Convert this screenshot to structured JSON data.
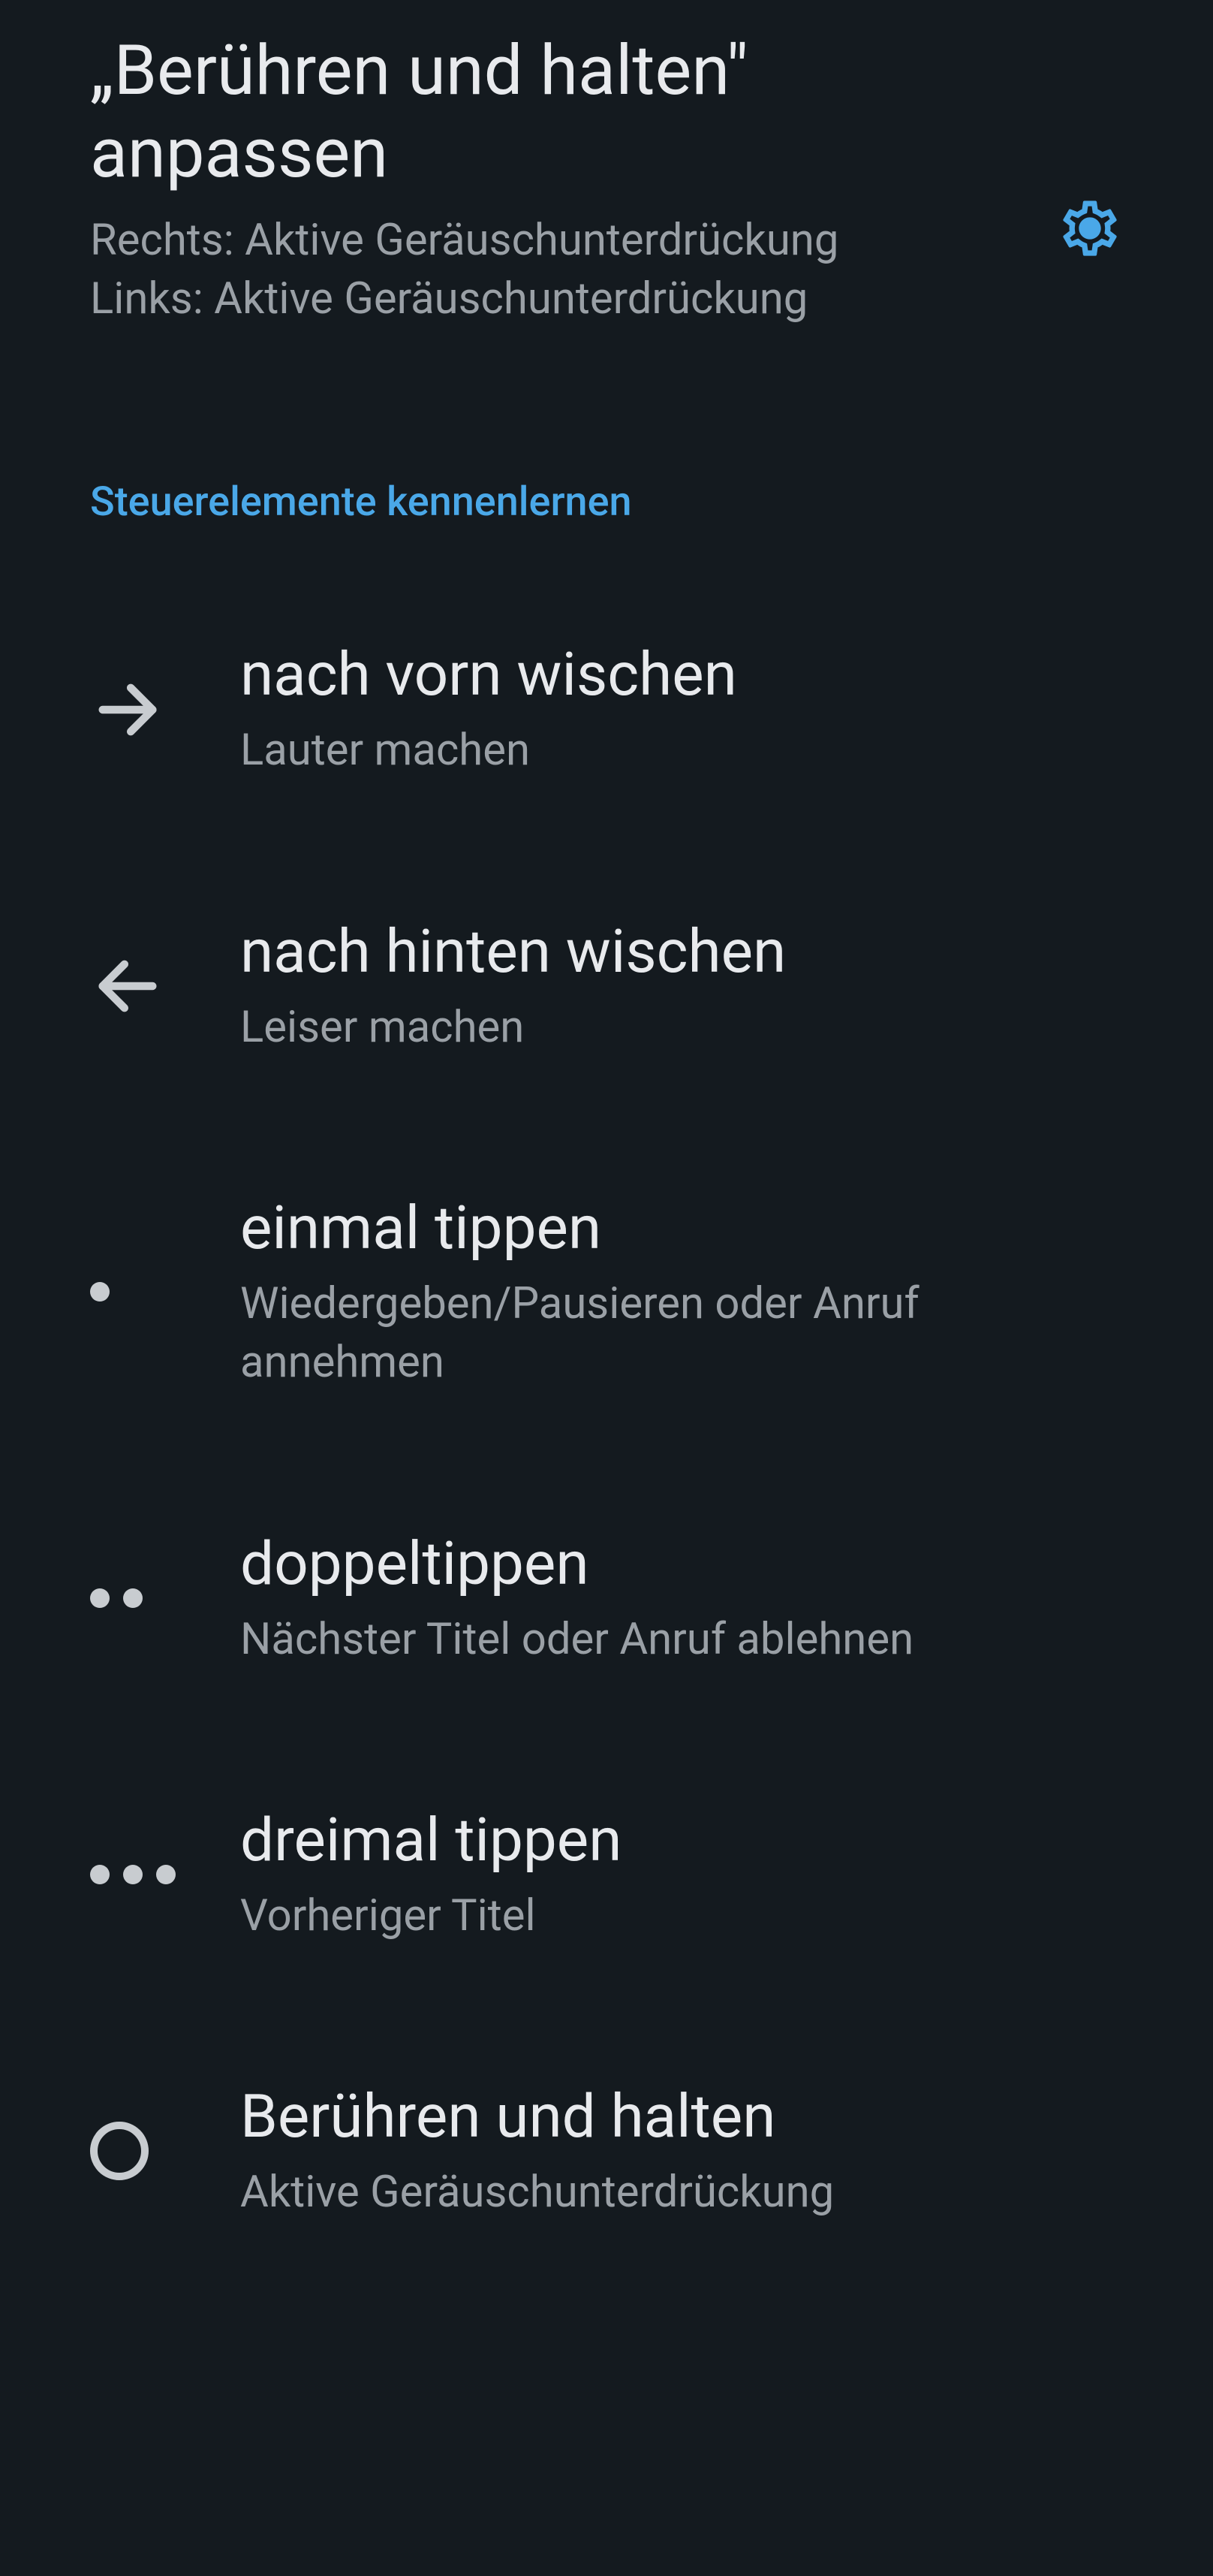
{
  "header": {
    "title": "„Berühren und halten\" anpassen",
    "subtitle": "Rechts: Aktive Geräuschunterdrückung\nLinks: Aktive Geräuschunterdrückung"
  },
  "section_header": "Steuerelemente kennenlernen",
  "gestures": [
    {
      "icon": "arrow-right",
      "title": "nach vorn wischen",
      "desc": "Lauter machen"
    },
    {
      "icon": "arrow-left",
      "title": "nach hinten wischen",
      "desc": "Leiser machen"
    },
    {
      "icon": "dot-1",
      "title": "einmal tippen",
      "desc": "Wiedergeben/Pausieren oder Anruf annehmen"
    },
    {
      "icon": "dot-2",
      "title": "doppeltippen",
      "desc": "Nächster Titel oder Anruf ablehnen"
    },
    {
      "icon": "dot-3",
      "title": "dreimal tippen",
      "desc": "Vorheriger Titel"
    },
    {
      "icon": "circle",
      "title": "Berühren und halten",
      "desc": "Aktive Geräuschunterdrückung"
    }
  ]
}
